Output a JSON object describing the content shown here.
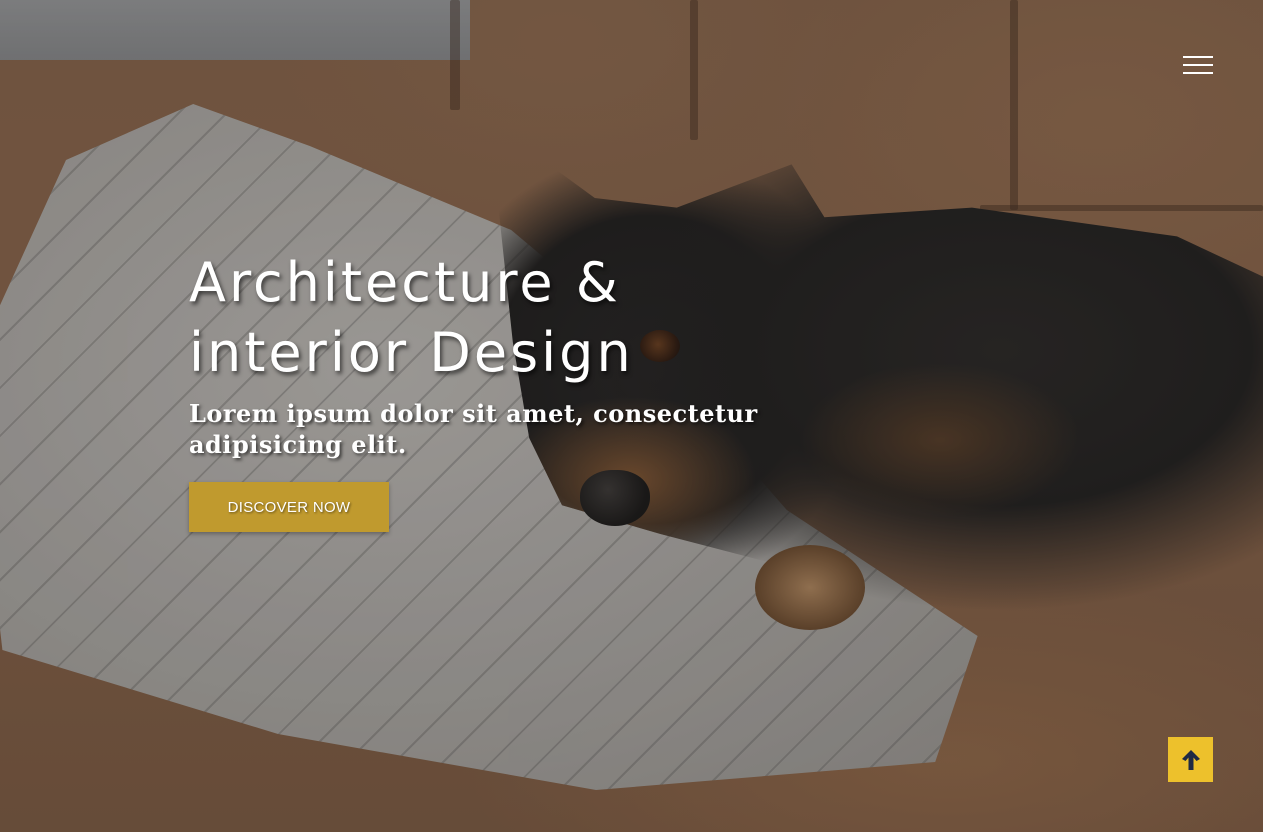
{
  "hero": {
    "title_line1": "Architecture &",
    "title_line2": "interior Design",
    "subtitle_line1": "Lorem ipsum dolor sit amet, consectetur",
    "subtitle_line2": "adipisicing elit.",
    "cta_label": "DISCOVER NOW"
  },
  "nav": {
    "menu_icon": "hamburger-menu-icon"
  },
  "scroll_top": {
    "icon": "arrow-up-icon"
  },
  "colors": {
    "accent": "#c09a2e",
    "scroll_top_bg": "#edc12c",
    "text": "#ffffff"
  }
}
